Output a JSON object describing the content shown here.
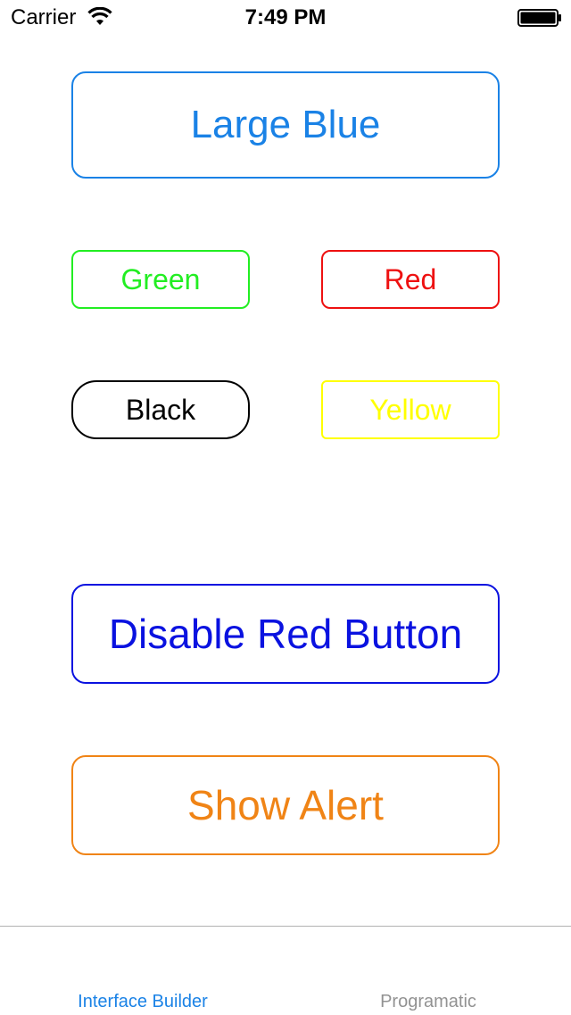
{
  "status_bar": {
    "carrier": "Carrier",
    "time": "7:49 PM",
    "wifi_icon": "wifi-icon",
    "battery_icon": "battery-full-icon"
  },
  "buttons": {
    "large_blue": {
      "label": "Large Blue",
      "color": "#1a82e6"
    },
    "green": {
      "label": "Green",
      "color": "#22ee22"
    },
    "red": {
      "label": "Red",
      "color": "#ee1111"
    },
    "black": {
      "label": "Black",
      "color": "#000000"
    },
    "yellow": {
      "label": "Yellow",
      "color": "#ffff00"
    },
    "disable_red": {
      "label": "Disable Red Button",
      "color": "#0a12e0"
    },
    "show_alert": {
      "label": "Show Alert",
      "color": "#f08416"
    }
  },
  "tab_bar": {
    "tabs": [
      {
        "label": "Interface Builder",
        "selected": true,
        "color": "#1a82e6"
      },
      {
        "label": "Programatic",
        "selected": false,
        "color": "#929292"
      }
    ]
  }
}
